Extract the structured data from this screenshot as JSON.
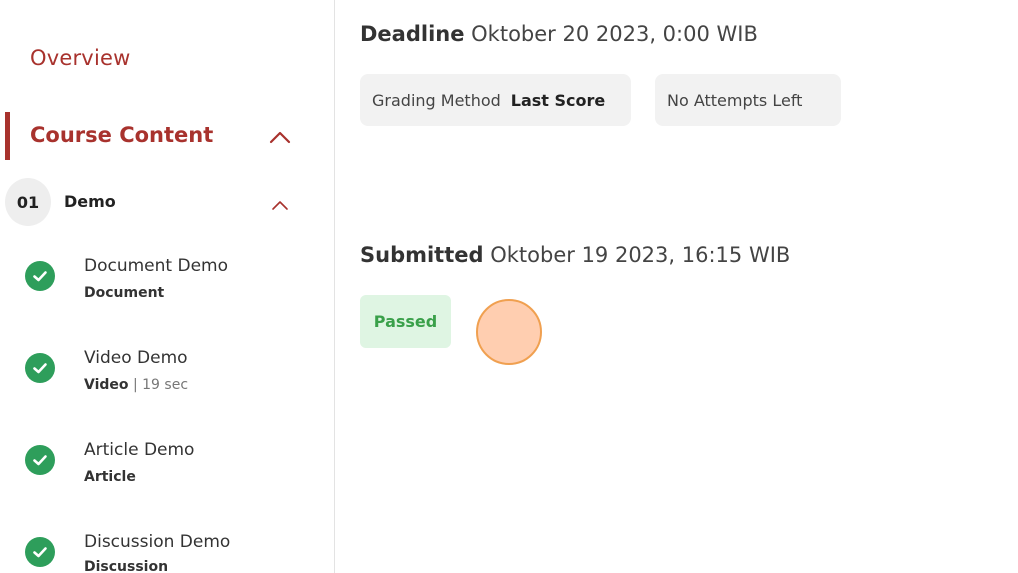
{
  "sidebar": {
    "overview_label": "Overview",
    "section_title": "Course Content",
    "module": {
      "number": "01",
      "title": "Demo"
    },
    "lessons": [
      {
        "title": "Document Demo",
        "type": "Document",
        "extra": ""
      },
      {
        "title": "Video Demo",
        "type": "Video",
        "extra": " | 19 sec"
      },
      {
        "title": "Article Demo",
        "type": "Article",
        "extra": ""
      },
      {
        "title": "Discussion Demo",
        "type": "Discussion",
        "extra": ""
      }
    ],
    "icons": {
      "section_toggle": "chevron-up-icon",
      "module_toggle": "chevron-up-icon",
      "lesson_status": "check-circle-icon"
    }
  },
  "main": {
    "deadline": {
      "label": "Deadline",
      "value": "Oktober 20 2023, 0:00 WIB"
    },
    "grading": {
      "label": "Grading Method",
      "value": "Last Score"
    },
    "attempts_text": "No Attempts Left",
    "submitted": {
      "label": "Submitted",
      "value": "Oktober 19 2023, 16:15 WIB"
    },
    "status_badge": "Passed"
  },
  "colors": {
    "accent": "#a8322d",
    "success": "#2e9e5b",
    "passed_bg": "#dff5e3",
    "passed_text": "#3aa04a",
    "chip_bg": "#f2f2f2"
  }
}
